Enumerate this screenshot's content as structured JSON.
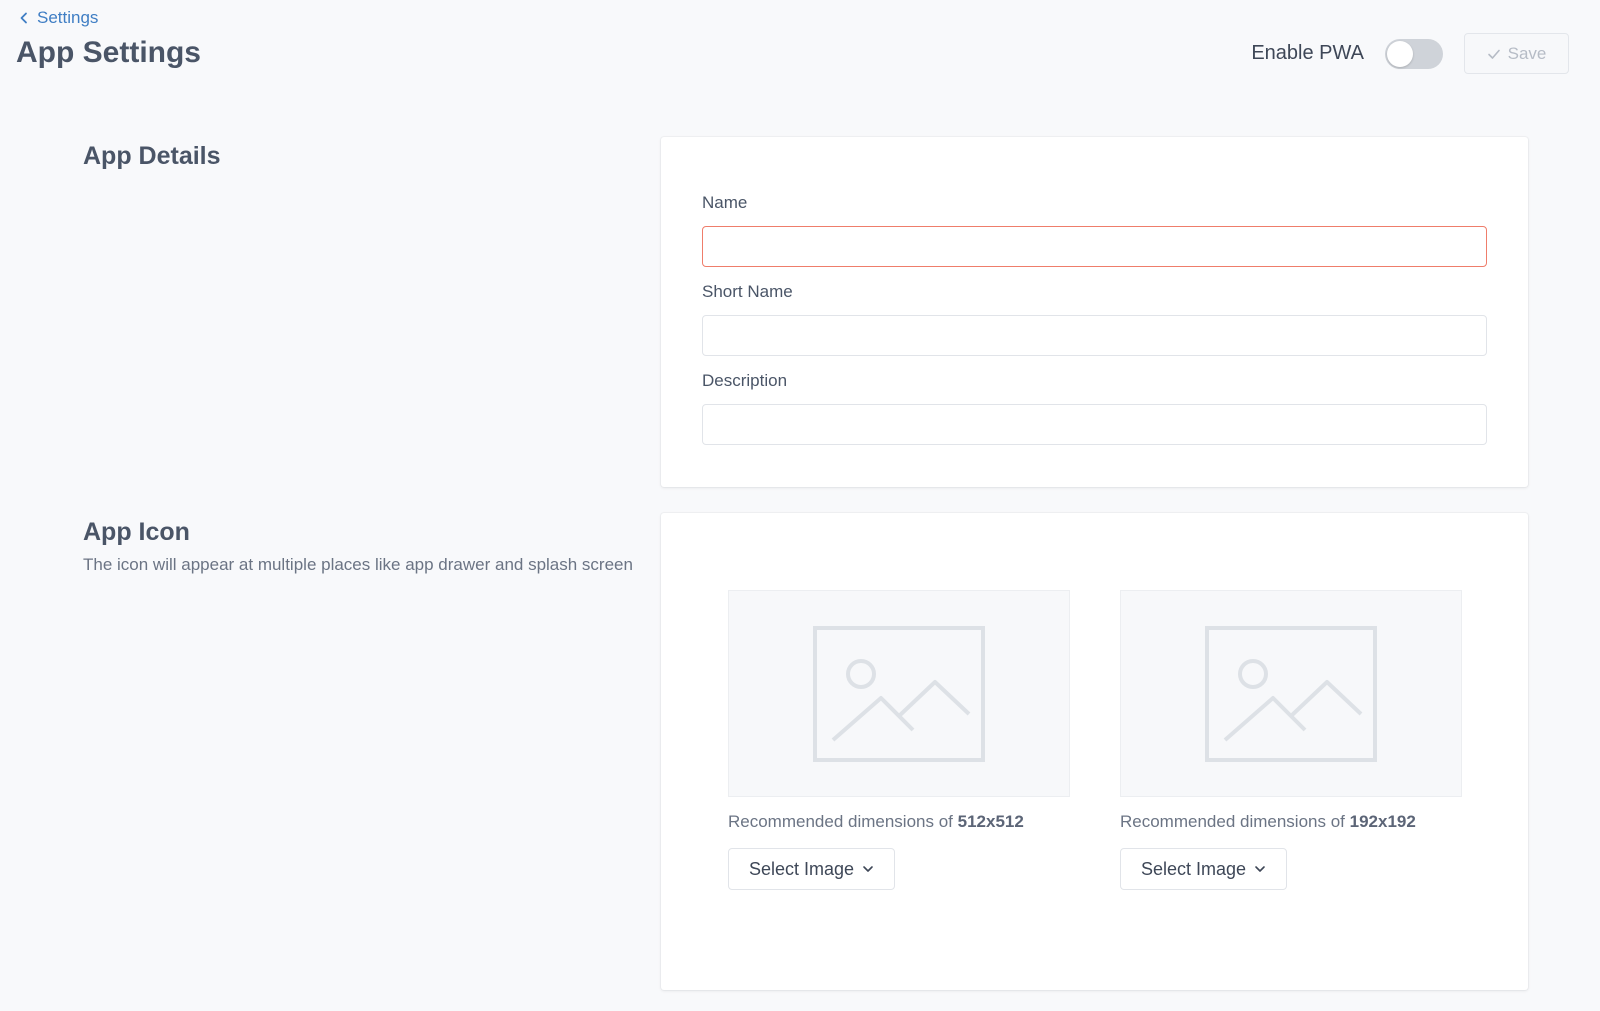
{
  "header": {
    "back_label": "Settings",
    "title": "App Settings",
    "pwa_label": "Enable PWA",
    "pwa_enabled": false,
    "save_label": "Save"
  },
  "app_details": {
    "title": "App Details",
    "fields": [
      {
        "label": "Name",
        "value": "",
        "state": "error"
      },
      {
        "label": "Short Name",
        "value": ""
      },
      {
        "label": "Description",
        "value": ""
      }
    ]
  },
  "app_icon": {
    "title": "App Icon",
    "description": "The icon will appear at multiple places like app drawer and splash screen",
    "images": [
      {
        "dims_prefix": "Recommended dimensions of",
        "dims_value": "512x512",
        "button_label": "Select Image"
      },
      {
        "dims_prefix": "Recommended dimensions of",
        "dims_value": "192x192",
        "button_label": "Select Image"
      }
    ]
  },
  "colors": {
    "link": "#3f7ec4",
    "error_border": "#ef7d6b",
    "background": "#f8f9fb"
  },
  "icons": [
    "chevron-left-icon",
    "check-icon",
    "image-placeholder-icon",
    "chevron-down-icon"
  ]
}
